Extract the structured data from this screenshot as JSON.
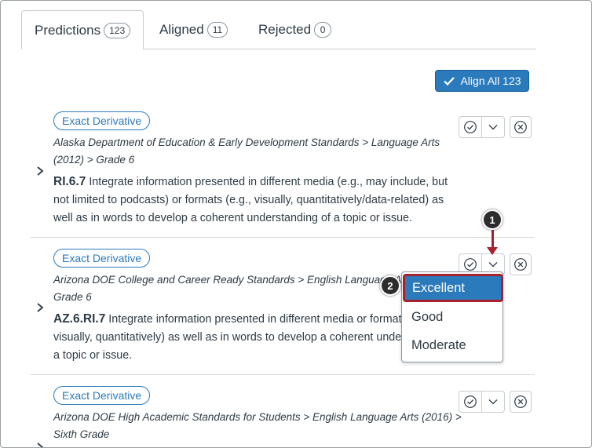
{
  "tabs": [
    {
      "label": "Predictions",
      "count": "123"
    },
    {
      "label": "Aligned",
      "count": "11"
    },
    {
      "label": "Rejected",
      "count": "0"
    }
  ],
  "align_all_label": "Align All 123",
  "rows": [
    {
      "pill": "Exact Derivative",
      "path_line1": "Alaska Department of Education & Early Development Standards > Language Arts",
      "path_line2": "(2012) > Grade 6",
      "code": "RI.6.7",
      "desc_line1": " Integrate information presented in different media (e.g., may include, but",
      "desc_line2": "not limited to podcasts) or formats (e.g., visually, quantitatively/data-related) as",
      "desc_line3": "well as in words to develop a coherent understanding of a topic or issue."
    },
    {
      "pill": "Exact Derivative",
      "path_line1": "Arizona DOE College and Career Ready Standards > English Language Art",
      "path_line2": "Grade 6",
      "code": "AZ.6.RI.7",
      "desc_line1": " Integrate information presented in different media or formats",
      "desc_line2": "visually, quantitatively) as well as in words to develop a coherent understa",
      "desc_line3": "a topic or issue."
    },
    {
      "pill": "Exact Derivative",
      "path_line1": "Arizona DOE High Academic Standards for Students > English Language Arts (2016) >",
      "path_line2": "Sixth Grade"
    }
  ],
  "dropdown": {
    "options": [
      "Excellent",
      "Good",
      "Moderate"
    ],
    "selected": "Excellent"
  },
  "callouts": [
    "1",
    "2"
  ],
  "colors": {
    "accent": "#2b7abc",
    "callout_arrow": "#a8212f",
    "callout_bg": "#2d2d2d"
  },
  "icons": {
    "align": "check-circle-icon",
    "more": "chevron-down-icon",
    "reject": "x-circle-icon",
    "expand": "chevron-right-icon",
    "align_all": "checkmark-icon"
  }
}
